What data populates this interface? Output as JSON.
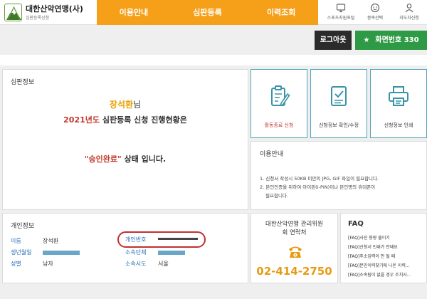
{
  "header": {
    "brand": "대한산악연맹(사)",
    "brand_sub": "심판등록신청",
    "nav": [
      "이용안내",
      "심판등록",
      "이력조회"
    ],
    "utils": [
      {
        "label": "스포츠지원포털",
        "icon": "home-monitor-icon"
      },
      {
        "label": "종목선택",
        "icon": "emoji-icon"
      },
      {
        "label": "지도자신청",
        "icon": "user-icon"
      }
    ]
  },
  "actions": {
    "logout": "로그아웃",
    "screen_number": "화면번호 330"
  },
  "judge_info": {
    "title": "심판정보",
    "name": "장석환",
    "name_suffix": "님",
    "year": "2021년도",
    "year_text": " 심판등록 신청 진행현황은",
    "status": "\"승인완료\"",
    "status_text": " 상태 입니다."
  },
  "tiles": [
    {
      "label": "활동종료 신청",
      "label_color": "#c0392b",
      "icon": "clipboard-edit-icon"
    },
    {
      "label": "신청정보 확인/수정",
      "label_color": "#333333",
      "icon": "checklist-icon"
    },
    {
      "label": "신청정보 인쇄",
      "label_color": "#333333",
      "icon": "printer-icon"
    }
  ],
  "usage_info": {
    "title": "이용안내",
    "lines": [
      "1. 신청서 작성시 50KB 미만의 JPG, GIF 파일이 필요합니다.",
      "2. 본인인증을 위하여 아이핀(I-PIN)이나 본인명의 휴대폰이",
      "필요합니다."
    ]
  },
  "personal_info": {
    "title": "개인정보",
    "name_label": "이름",
    "name_value": "장석환",
    "birth_label": "생년월일",
    "gender_label": "성별",
    "gender_value": "남자",
    "id_label": "개인번호",
    "org_label": "소속단체",
    "region_label": "소속시도",
    "region_value": "서울"
  },
  "contact": {
    "title_line1": "대한산악연맹 관리위원",
    "title_line2": "회 연락처",
    "phone": "02-414-2750",
    "icon": "telephone-icon"
  },
  "faq": {
    "title": "FAQ",
    "items": [
      "[FAQ]사진 용량 줄이기",
      "[FAQ]신청서 인쇄가 안돼요",
      "[FAQ]주소입력이 안 될 때",
      "[FAQ]본인이력찾기에 나온 이력...",
      "[FAQ]소속팀이 없을 경우 조치사..."
    ]
  },
  "colors": {
    "nav_orange": "#f6a01a",
    "screen_green": "#2f9a45",
    "name_yellow": "#e8a100",
    "status_red": "#c0392b",
    "label_blue": "#2a6db8",
    "tile_border": "#4fa6b8"
  }
}
